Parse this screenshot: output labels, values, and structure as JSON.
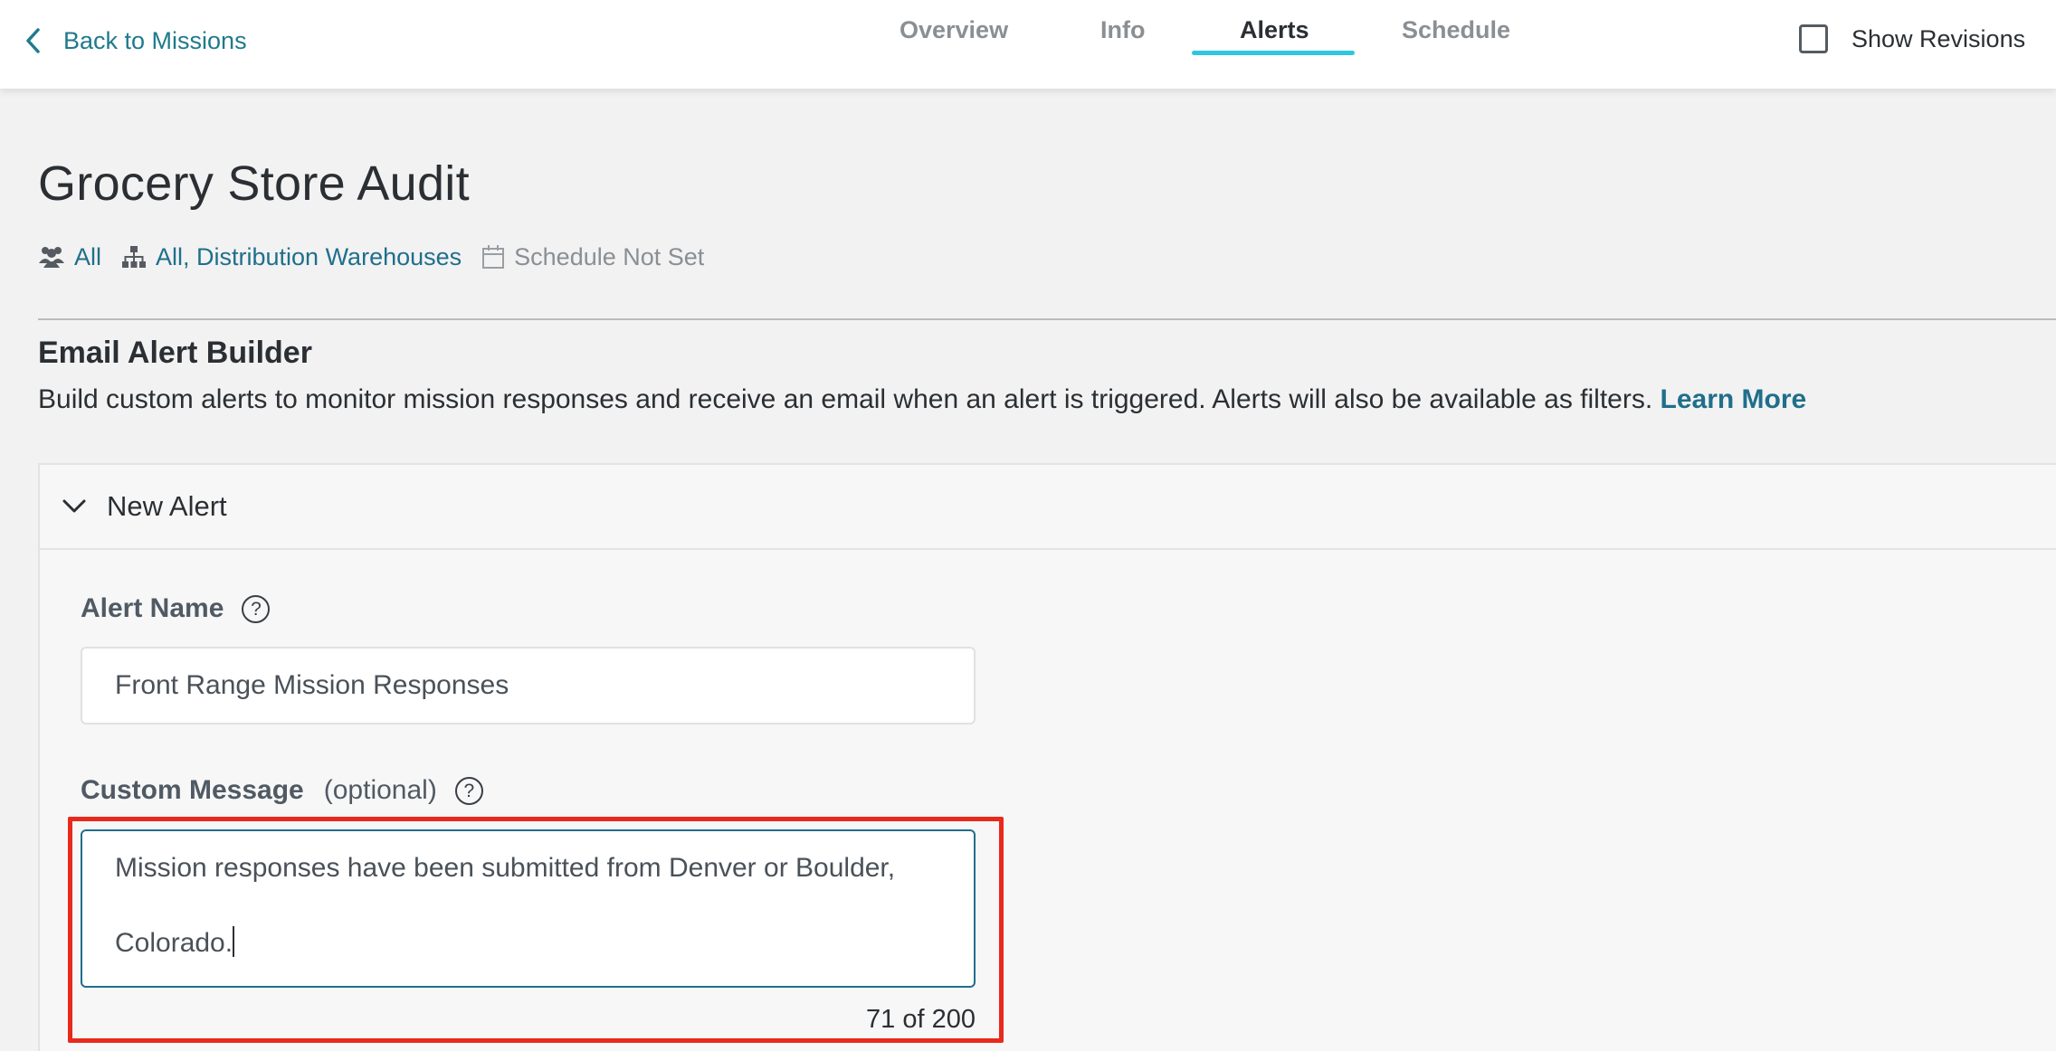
{
  "nav": {
    "back_label": "Back to Missions",
    "tabs": [
      {
        "label": "Overview",
        "active": false
      },
      {
        "label": "Info",
        "active": false
      },
      {
        "label": "Alerts",
        "active": true
      },
      {
        "label": "Schedule",
        "active": false
      }
    ],
    "show_revisions_label": "Show Revisions",
    "show_revisions_checked": false
  },
  "mission": {
    "title": "Grocery Store Audit",
    "audience": "All",
    "locations": "All, Distribution Warehouses",
    "schedule": "Schedule Not Set"
  },
  "builder": {
    "title": "Email Alert Builder",
    "description": "Build custom alerts to monitor mission responses and receive an email when an alert is triggered. Alerts will also be available as filters.",
    "learn_more": "Learn More"
  },
  "alert": {
    "header": "New Alert",
    "name_label": "Alert Name",
    "name_value": "Front Range Mission Responses",
    "message_label": "Custom Message",
    "message_optional": "(optional)",
    "message_line1": "Mission responses have been submitted from Denver or Boulder,",
    "message_line2": "Colorado.",
    "char_count": "71 of 200"
  },
  "colors": {
    "accent": "#2ec6e0",
    "link": "#1f6f8b",
    "highlight": "#e8291c"
  }
}
